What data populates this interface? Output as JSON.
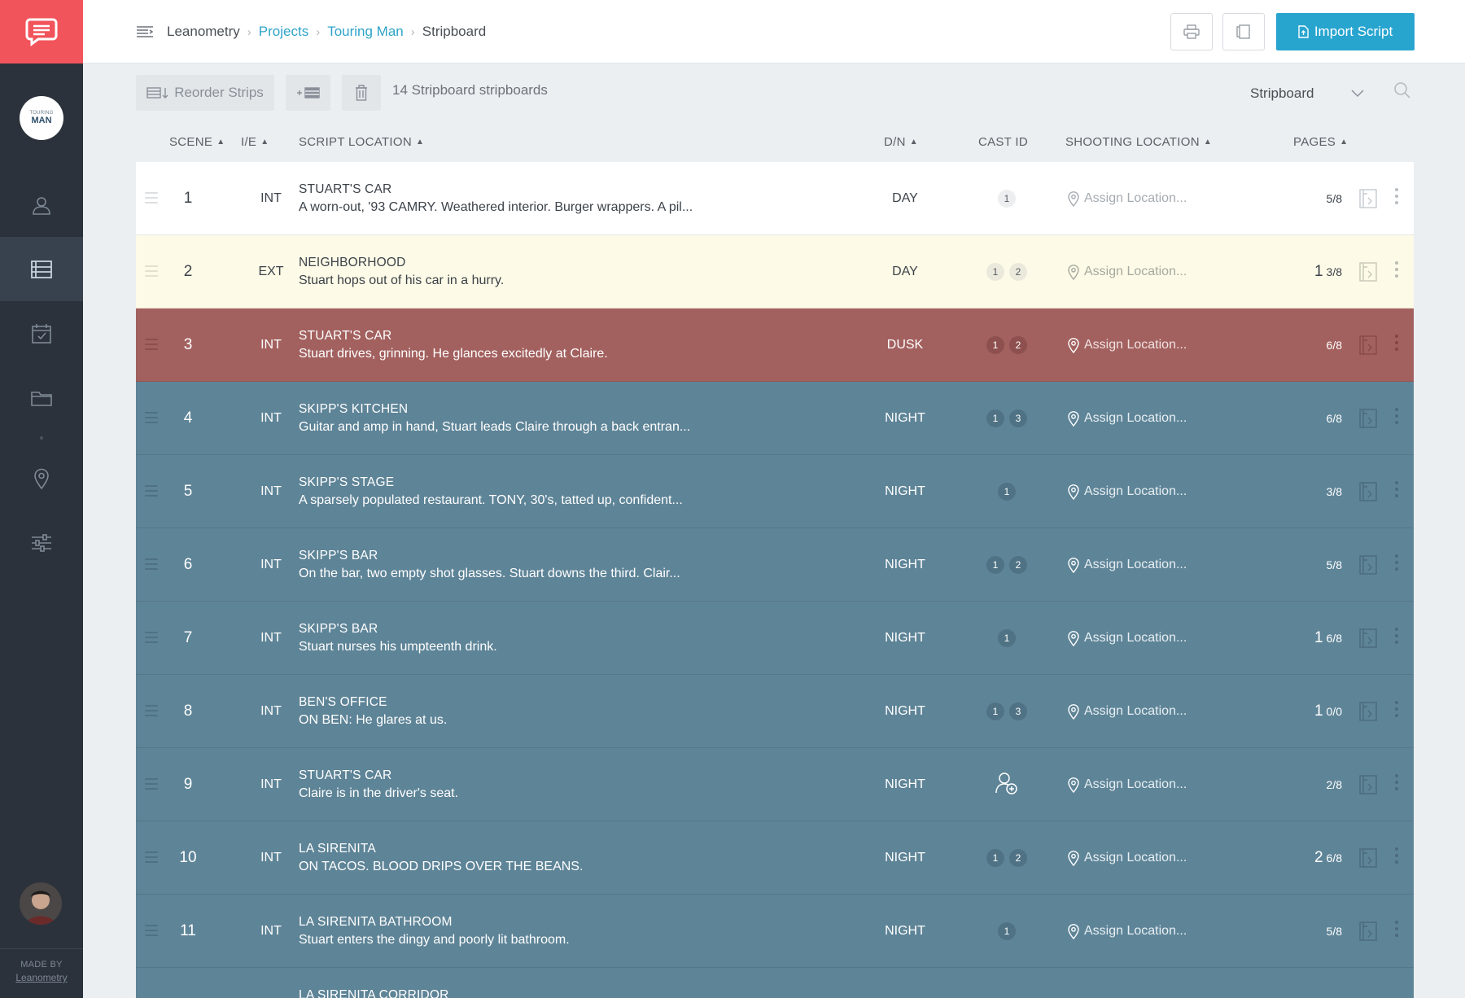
{
  "header": {
    "breadcrumb": [
      "Leanometry",
      "Projects",
      "Touring Man",
      "Stripboard"
    ],
    "import_label": "Import Script"
  },
  "sidebar": {
    "project_badge": [
      "TOURING",
      "MAN"
    ],
    "made_by": "MADE BY",
    "made_by_name": "Leanometry"
  },
  "toolbar": {
    "reorder_label": "Reorder Strips",
    "count_text": "14 Stripboard stripboards",
    "view_select": "Stripboard"
  },
  "columns": {
    "scene": "SCENE",
    "ie": "I/E",
    "script_location": "SCRIPT LOCATION",
    "dn": "D/N",
    "cast_id": "CAST ID",
    "shooting_location": "SHOOTING LOCATION",
    "pages": "PAGES"
  },
  "rows": [
    {
      "scene": "1",
      "ie": "INT",
      "location": "STUART'S CAR",
      "description": "A worn-out, '93 CAMRY. Weathered interior. Burger wrappers. A pil...",
      "dn": "DAY",
      "cast": [
        "1"
      ],
      "shooting": "Assign Location...",
      "pages_whole": "",
      "pages_frac": "5/8",
      "theme": "white"
    },
    {
      "scene": "2",
      "ie": "EXT",
      "location": "NEIGHBORHOOD",
      "description": "Stuart hops out of his car in a hurry.",
      "dn": "DAY",
      "cast": [
        "1",
        "2"
      ],
      "shooting": "Assign Location...",
      "pages_whole": "1",
      "pages_frac": "3/8",
      "theme": "yellow"
    },
    {
      "scene": "3",
      "ie": "INT",
      "location": "STUART'S CAR",
      "description": "Stuart drives, grinning. He glances excitedly at Claire.",
      "dn": "DUSK",
      "cast": [
        "1",
        "2"
      ],
      "shooting": "Assign Location...",
      "pages_whole": "",
      "pages_frac": "6/8",
      "theme": "red"
    },
    {
      "scene": "4",
      "ie": "INT",
      "location": "SKIPP'S KITCHEN",
      "description": "Guitar and amp in hand, Stuart leads Claire through a back entran...",
      "dn": "NIGHT",
      "cast": [
        "1",
        "3"
      ],
      "shooting": "Assign Location...",
      "pages_whole": "",
      "pages_frac": "6/8",
      "theme": "blue"
    },
    {
      "scene": "5",
      "ie": "INT",
      "location": "SKIPP'S STAGE",
      "description": "A sparsely populated restaurant. TONY, 30's, tatted up, confident...",
      "dn": "NIGHT",
      "cast": [
        "1"
      ],
      "shooting": "Assign Location...",
      "pages_whole": "",
      "pages_frac": "3/8",
      "theme": "blue"
    },
    {
      "scene": "6",
      "ie": "INT",
      "location": "SKIPP'S BAR",
      "description": "On the bar, two empty shot glasses. Stuart downs the third. Clair...",
      "dn": "NIGHT",
      "cast": [
        "1",
        "2"
      ],
      "shooting": "Assign Location...",
      "pages_whole": "",
      "pages_frac": "5/8",
      "theme": "blue"
    },
    {
      "scene": "7",
      "ie": "INT",
      "location": "SKIPP'S BAR",
      "description": "Stuart nurses his umpteenth drink.",
      "dn": "NIGHT",
      "cast": [
        "1"
      ],
      "shooting": "Assign Location...",
      "pages_whole": "1",
      "pages_frac": "6/8",
      "theme": "blue"
    },
    {
      "scene": "8",
      "ie": "INT",
      "location": "BEN'S OFFICE",
      "description": "ON BEN: He glares at us.",
      "dn": "NIGHT",
      "cast": [
        "1",
        "3"
      ],
      "shooting": "Assign Location...",
      "pages_whole": "1",
      "pages_frac": "0/0",
      "theme": "blue"
    },
    {
      "scene": "9",
      "ie": "INT",
      "location": "STUART'S CAR",
      "description": "Claire is in the driver's seat.",
      "dn": "NIGHT",
      "cast": [],
      "shooting": "Assign Location...",
      "pages_whole": "",
      "pages_frac": "2/8",
      "theme": "blue"
    },
    {
      "scene": "10",
      "ie": "INT",
      "location": "LA SIRENITA",
      "description": "ON TACOS. BLOOD DRIPS OVER THE BEANS.",
      "dn": "NIGHT",
      "cast": [
        "1",
        "2"
      ],
      "shooting": "Assign Location...",
      "pages_whole": "2",
      "pages_frac": "6/8",
      "theme": "blue"
    },
    {
      "scene": "11",
      "ie": "INT",
      "location": "LA SIRENITA BATHROOM",
      "description": "Stuart enters the dingy and poorly lit bathroom.",
      "dn": "NIGHT",
      "cast": [
        "1"
      ],
      "shooting": "Assign Location...",
      "pages_whole": "",
      "pages_frac": "5/8",
      "theme": "blue"
    },
    {
      "scene": "",
      "ie": "",
      "location": "LA SIRENITA CORRIDOR",
      "description": "",
      "dn": "",
      "cast": [],
      "shooting": "",
      "pages_whole": "",
      "pages_frac": "",
      "theme": "blue"
    }
  ]
}
